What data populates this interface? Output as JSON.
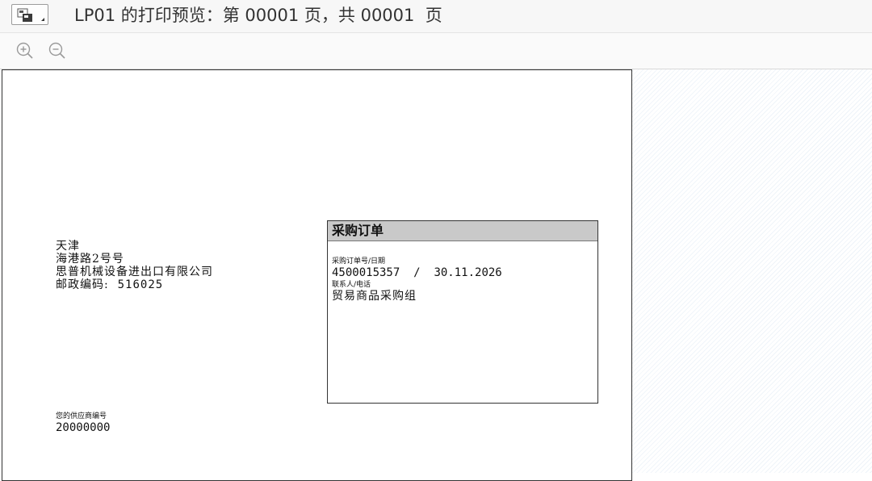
{
  "window": {
    "title": "LP01 的打印预览：第 00001 页，共 00001  页"
  },
  "toolbar": {
    "zoom_in_icon": "zoom-in-icon",
    "zoom_out_icon": "zoom-out-icon"
  },
  "document": {
    "address": {
      "line1": "天津",
      "line2": "海港路2号号",
      "line3": "思普机械设备进出口有限公司",
      "postal_label": "邮政编码:",
      "postal_code": "516025"
    },
    "po_box": {
      "title": "采购订单",
      "po_label": "采购订单号/日期",
      "po_number": "4500015357",
      "separator": "/",
      "po_date": "30.11.2026",
      "contact_label": "联系人/电话",
      "contact_value": "贸易商品采购组"
    },
    "vendor": {
      "label": "您的供应商编号",
      "number": "20000000"
    }
  }
}
